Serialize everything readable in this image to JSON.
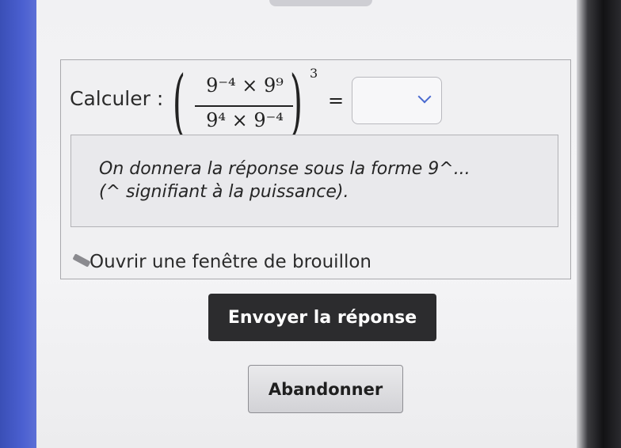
{
  "question": {
    "calc_label": "Calculer :",
    "numerator": "9⁻⁴ × 9⁹",
    "denominator": "9⁴ × 9⁻⁴",
    "outer_exponent": "3",
    "equals": "=",
    "answer_value": ""
  },
  "hint": {
    "line1": "On donnera la réponse sous la forme 9^...",
    "line2": "(^ signifiant à la puissance)."
  },
  "draft": {
    "label": "Ouvrir une fenêtre de brouillon",
    "icon": "pencil-icon"
  },
  "actions": {
    "submit_label": "Envoyer la réponse",
    "abandon_label": "Abandonner"
  },
  "colors": {
    "submit_bg": "#2c2c2e",
    "chevron": "#4a6ad0",
    "sidebar_blue": "#4a5fd0"
  }
}
